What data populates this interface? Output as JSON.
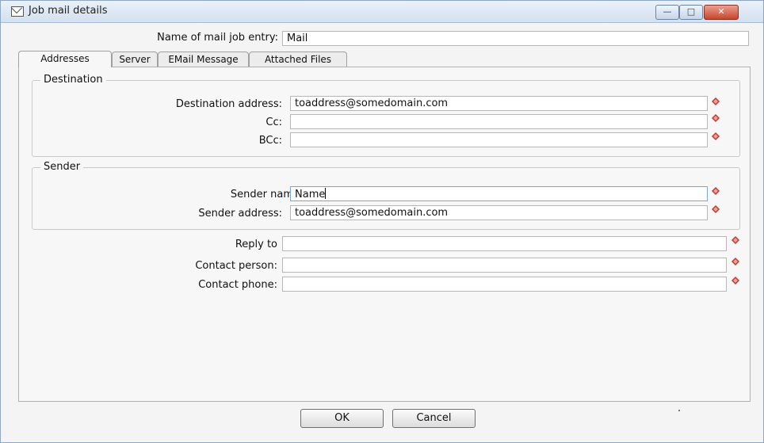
{
  "window": {
    "title": "Job mail details",
    "icon": "envelope-icon",
    "controls": {
      "minimize": "—",
      "maximize": "□",
      "close": "✕"
    }
  },
  "job_entry": {
    "label": "Name of mail job entry:",
    "value": "Mail"
  },
  "tabs": [
    {
      "label": "Addresses",
      "active": true
    },
    {
      "label": "Server",
      "active": false
    },
    {
      "label": "EMail Message",
      "active": false
    },
    {
      "label": "Attached Files",
      "active": false
    }
  ],
  "destination": {
    "title": "Destination",
    "address": {
      "label": "Destination address:",
      "value": "toaddress@somedomain.com"
    },
    "cc": {
      "label": "Cc:",
      "value": ""
    },
    "bcc": {
      "label": "BCc:",
      "value": ""
    }
  },
  "sender": {
    "title": "Sender",
    "name": {
      "label": "Sender name",
      "value": "Name"
    },
    "address": {
      "label": "Sender address:",
      "value": "toaddress@somedomain.com"
    }
  },
  "extra": {
    "reply_to": {
      "label": "Reply to",
      "value": ""
    },
    "contact_person": {
      "label": "Contact person:",
      "value": ""
    },
    "contact_phone": {
      "label": "Contact phone:",
      "value": ""
    }
  },
  "buttons": {
    "ok": "OK",
    "cancel": "Cancel"
  },
  "colors": {
    "variable_marker": "#c0392b",
    "title_gradient_top": "#eaf1f9",
    "close_button": "#c9452d"
  }
}
